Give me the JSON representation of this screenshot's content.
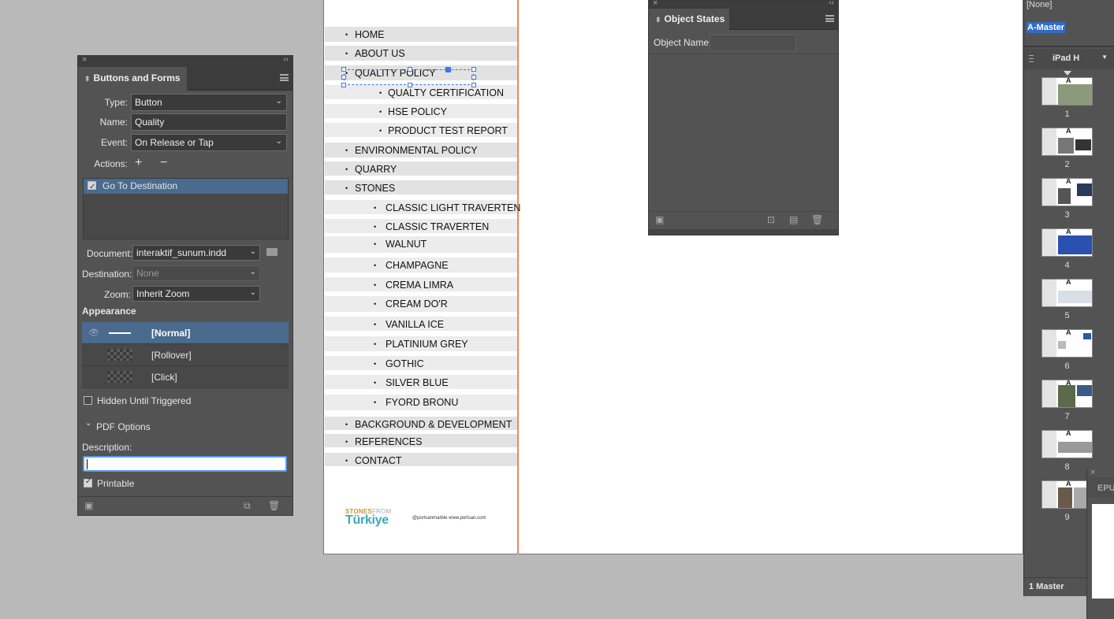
{
  "buttons_forms": {
    "title": "Buttons and Forms",
    "type_label": "Type:",
    "type_value": "Button",
    "name_label": "Name:",
    "name_value": "Quality",
    "event_label": "Event:",
    "event_value": "On Release or Tap",
    "actions_label": "Actions:",
    "action_item": "Go To Destination",
    "document_label": "Document:",
    "document_value": "interaktif_sunum.indd",
    "destination_label": "Destination:",
    "destination_value": "None",
    "zoom_label": "Zoom:",
    "zoom_value": "Inherit Zoom",
    "appearance_label": "Appearance",
    "appearance": [
      "[Normal]",
      "[Rollover]",
      "[Click]"
    ],
    "hidden_label": "Hidden Until Triggered",
    "pdf_options_label": "PDF Options",
    "description_label": "Description:",
    "description_value": "",
    "printable_label": "Printable"
  },
  "document": {
    "menu": [
      {
        "label": "HOME",
        "level": 0
      },
      {
        "label": "ABOUT US",
        "level": 0
      },
      {
        "label": "QUALITY POLICY",
        "level": 0
      },
      {
        "label": "QUALTY CERTIFICATION",
        "level": 2
      },
      {
        "label": "HSE POLICY",
        "level": 2
      },
      {
        "label": "PRODUCT TEST REPORT",
        "level": 2
      },
      {
        "label": "ENVIRONMENTAL POLICY",
        "level": 0
      },
      {
        "label": "QUARRY",
        "level": 0
      },
      {
        "label": "STONES",
        "level": 0
      },
      {
        "label": "CLASSIC LIGHT TRAVERTEN",
        "level": 1
      },
      {
        "label": "CLASSIC TRAVERTEN",
        "level": 1
      },
      {
        "label": "WALNUT",
        "level": 1
      },
      {
        "label": "CHAMPAGNE",
        "level": 1
      },
      {
        "label": "CREMA LIMRA",
        "level": 1
      },
      {
        "label": "CREAM DO'R",
        "level": 1
      },
      {
        "label": "VANILLA ICE",
        "level": 1
      },
      {
        "label": "PLATINIUM GREY",
        "level": 1
      },
      {
        "label": "GOTHIC",
        "level": 1
      },
      {
        "label": "SILVER BLUE",
        "level": 1
      },
      {
        "label": "FYORD BRONU",
        "level": 1
      },
      {
        "label": "BACKGROUND & DEVELOPMENT",
        "level": 0
      },
      {
        "label": "REFERENCES",
        "level": 0
      },
      {
        "label": "CONTACT",
        "level": 0
      }
    ],
    "logo_top": "STONES",
    "logo_top_light": "FROM",
    "logo_main": "Türkiye",
    "footer_text": "@portsanmarble www.portsan.com"
  },
  "object_states": {
    "title": "Object States",
    "object_name_label": "Object Name:"
  },
  "pages_panel": {
    "none_label": "[None]",
    "master_label": "A-Master",
    "preset_label": "iPad H",
    "page_numbers": [
      "1",
      "2",
      "3",
      "4",
      "5",
      "6",
      "7",
      "8",
      "9"
    ],
    "footer": "1 Master"
  },
  "epub_panel": {
    "tab_label": "EPU"
  },
  "colors": {
    "selection_blue": "#3b78e7",
    "panel_bg": "#535353",
    "highlight": "#4a6a8e",
    "divider_orange": "#e88a5a"
  }
}
